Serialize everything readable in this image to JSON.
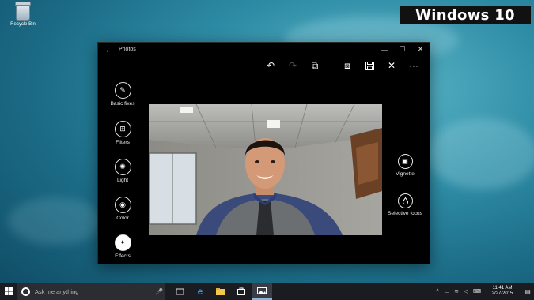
{
  "desktop": {
    "recycle_bin_label": "Recycle Bin"
  },
  "badge": {
    "text": "Windows 10"
  },
  "window": {
    "title": "Photos",
    "controls": {
      "back": "←",
      "minimize": "—",
      "maximize": "☐",
      "close": "✕"
    },
    "toolbar": {
      "undo": "↶",
      "redo": "↷",
      "compare": "⧉",
      "save_copy": "⧈",
      "save": "💾",
      "cancel": "✕",
      "more": "···"
    },
    "left_tools": [
      {
        "label": "Basic fixes",
        "icon": "wand-icon",
        "glyph": "✎",
        "active": false
      },
      {
        "label": "Filters",
        "icon": "filter-icon",
        "glyph": "⊞",
        "active": false
      },
      {
        "label": "Light",
        "icon": "sun-icon",
        "glyph": "✺",
        "active": false
      },
      {
        "label": "Color",
        "icon": "palette-icon",
        "glyph": "◉",
        "active": false
      },
      {
        "label": "Effects",
        "icon": "effects-icon",
        "glyph": "✦",
        "active": true
      }
    ],
    "right_tools": [
      {
        "label": "Vignette",
        "icon": "vignette-icon",
        "glyph": "▣"
      },
      {
        "label": "Selective focus",
        "icon": "drop-icon",
        "glyph": "💧"
      }
    ]
  },
  "taskbar": {
    "search_placeholder": "Ask me anything",
    "time": "11:41 AM",
    "date": "2/27/2015",
    "accent": "#8ab4d8"
  }
}
